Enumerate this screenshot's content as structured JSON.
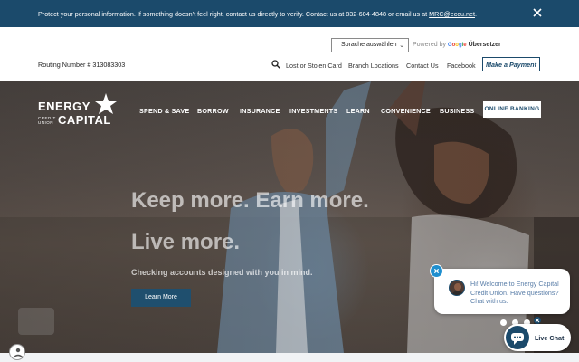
{
  "alert": {
    "text": "Protect your personal information. If something doesn’t feel right, contact us directly to verify.  Contact us at 832-604-4848 or email us at ",
    "email": "MRC@eccu.net",
    "period": "."
  },
  "utility": {
    "language_select": "Sprache auswählen",
    "powered_by": "Powered by",
    "google_letters": [
      "G",
      "o",
      "o",
      "g",
      "l",
      "e"
    ],
    "translate": "Übersetzer",
    "routing": "Routing Number # 313083303",
    "links": [
      "Lost or Stolen Card",
      "Branch Locations",
      "Contact Us",
      "Facebook"
    ],
    "make_payment": "Make a Payment"
  },
  "logo": {
    "top": "ENERGY",
    "credit": "CREDIT",
    "union": "UNION",
    "bottom": "CAPITAL"
  },
  "nav": {
    "items": [
      "SPEND & SAVE",
      "BORROW",
      "INSURANCE",
      "INVESTMENTS",
      "LEARN",
      "CONVENIENCE",
      "BUSINESS"
    ],
    "online_banking": "ONLINE BANKING"
  },
  "hero": {
    "headline_1": "Keep more. Earn more.",
    "headline_2": "Live more.",
    "subtext": "Checking accounts designed with you in mind.",
    "cta": "Learn More"
  },
  "chat": {
    "message": "Hi! Welcome to Energy Capital Credit Union. Have questions? Chat with us.",
    "live_chat": "Live Chat"
  },
  "colors": {
    "brand": "#1b4a6b",
    "chat_blue": "#1f8fcf"
  }
}
